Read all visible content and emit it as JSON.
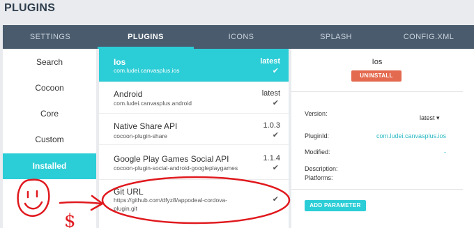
{
  "page_title": "PLUGINS",
  "tabs": [
    {
      "label": "SETTINGS"
    },
    {
      "label": "PLUGINS",
      "active": true
    },
    {
      "label": "ICONS"
    },
    {
      "label": "SPLASH"
    },
    {
      "label": "CONFIG.XML"
    }
  ],
  "sidebar": {
    "items": [
      {
        "label": "Search"
      },
      {
        "label": "Cocoon"
      },
      {
        "label": "Core"
      },
      {
        "label": "Custom"
      },
      {
        "label": "Installed",
        "active": true
      }
    ]
  },
  "plugins": [
    {
      "name": "Ios",
      "id": "com.ludei.canvasplus.ios",
      "version": "latest",
      "installed": true,
      "selected": true
    },
    {
      "name": "Android",
      "id": "com.ludei.canvasplus.android",
      "version": "latest",
      "installed": true
    },
    {
      "name": "Native Share API",
      "id": "cocoon-plugin-share",
      "version": "1.0.3",
      "installed": true
    },
    {
      "name": "Google Play Games Social API",
      "id": "cocoon-plugin-social-android-googleplaygames",
      "version": "1.1.4",
      "installed": true
    },
    {
      "name": "Git URL",
      "id_line1": "https://github.com/dfyz8/appodeal-cordova-",
      "id_line2": "plugin.git",
      "version": "-",
      "installed": true
    }
  ],
  "detail": {
    "title": "Ios",
    "uninstall_label": "UNINSTALL",
    "version_label": "Version:",
    "version_value": "latest ▾",
    "plugin_id_label": "PluginId:",
    "plugin_id_value": "com.ludei.canvasplus.ios",
    "modified_label": "Modified:",
    "modified_value": "-",
    "description_label": "Description:",
    "platforms_label": "Platforms:",
    "add_parameter_label": "ADD PARAMETER"
  },
  "annotation": {
    "dollar_text": "$",
    "color": "#e0191e"
  },
  "colors": {
    "accent": "#2bcdd6",
    "tabbar": "#4a5b6d",
    "uninstall": "#e46a4f",
    "link": "#2bb9c4"
  }
}
